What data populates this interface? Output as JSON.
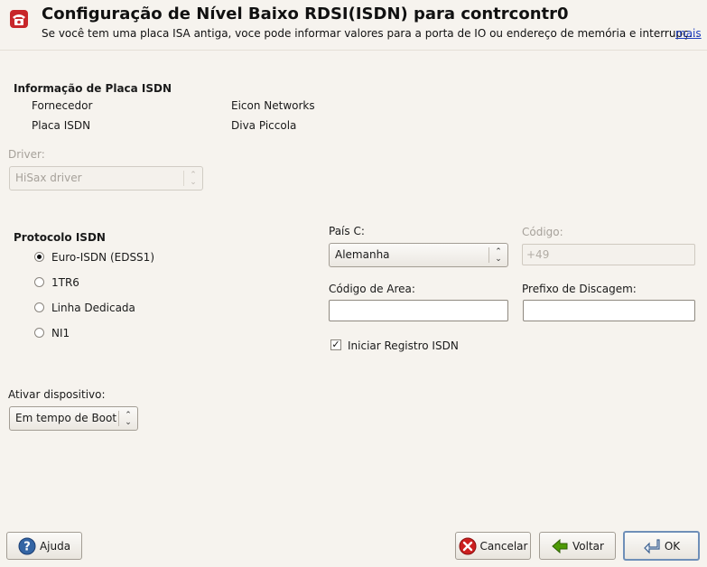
{
  "header": {
    "title": "Configuração de Nível Baixo RDSI(ISDN) para contrcontr0",
    "subtitle": "Se você tem uma placa ISA antiga, voce pode informar valores para a porta de IO ou endereço de memória e interrupç…",
    "more_link": "mais",
    "icon": "telephone-icon"
  },
  "card_info": {
    "heading": "Informação de Placa ISDN",
    "vendor_label": "Fornecedor",
    "vendor_value": "Eicon Networks",
    "card_label": "Placa ISDN",
    "card_value": "Diva Piccola"
  },
  "driver": {
    "label": "Driver:",
    "value": "HiSax driver"
  },
  "protocol": {
    "heading": "Protocolo ISDN",
    "options": [
      "Euro-ISDN (EDSS1)",
      "1TR6",
      "Linha Dedicada",
      "NI1"
    ],
    "selected": "Euro-ISDN (EDSS1)"
  },
  "country": {
    "label": "País C:",
    "value": "Alemanha",
    "code_label": "Código:",
    "code_value": "+49"
  },
  "area_code": {
    "label": "Código de Area:",
    "value": ""
  },
  "dial_prefix": {
    "label": "Prefixo de Discagem:",
    "value": ""
  },
  "isdn_log": {
    "label": "Iniciar Registro ISDN",
    "checked": true
  },
  "activate": {
    "label": "Ativar dispositivo:",
    "value": "Em tempo de Boot"
  },
  "footer": {
    "help": "Ajuda",
    "cancel": "Cancelar",
    "back": "Voltar",
    "ok": "OK"
  },
  "colors": {
    "background": "#f6f3ee",
    "link": "#1f3fbf",
    "header_icon": "#c8262a"
  }
}
